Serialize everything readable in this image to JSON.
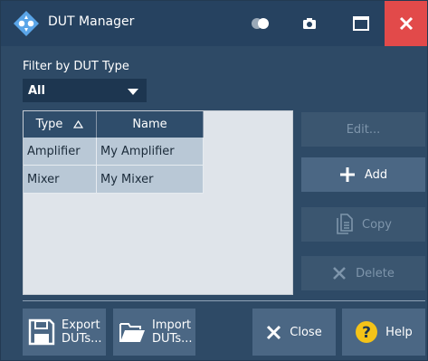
{
  "window": {
    "title": "DUT Manager"
  },
  "filter": {
    "label": "Filter by DUT Type",
    "selected": "All"
  },
  "table": {
    "columns": [
      {
        "label": "Type",
        "sort_icon": "triangle-up-icon"
      },
      {
        "label": "Name"
      }
    ],
    "rows": [
      {
        "type": "Amplifier",
        "name": "My Amplifier"
      },
      {
        "type": "Mixer",
        "name": "My Mixer"
      }
    ]
  },
  "actions": {
    "edit": {
      "label": "Edit...",
      "enabled": false
    },
    "add": {
      "label": "Add",
      "enabled": true
    },
    "copy": {
      "label": "Copy",
      "enabled": false
    },
    "delete": {
      "label": "Delete",
      "enabled": false
    }
  },
  "footer": {
    "export": {
      "line1": "Export",
      "line2": "DUTs..."
    },
    "import": {
      "line1": "Import",
      "line2": "DUTs..."
    },
    "close": {
      "label": "Close"
    },
    "help": {
      "label": "Help"
    }
  },
  "colors": {
    "window_bg": "#2e4a66",
    "titlebar_bg": "#264260",
    "close_red": "#e24a4a",
    "button_bg": "#4b6784",
    "help_yellow": "#f4c318"
  }
}
